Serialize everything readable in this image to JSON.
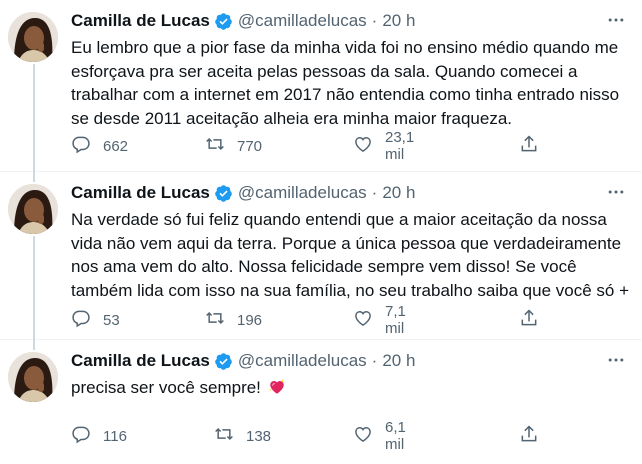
{
  "tweets": [
    {
      "author": "Camilla de Lucas",
      "handle": "@camilladelucas",
      "separator": "·",
      "time": "20 h",
      "text": "Eu lembro que a pior fase da minha vida foi no ensino médio quando me esforçava pra ser aceita pelas pessoas da sala. Quando comecei a trabalhar com a internet em 2017 não entendia como tinha entrado nisso se desde 2011 aceitação alheia era minha maior fraqueza.",
      "replies": "662",
      "retweets": "770",
      "likes": "23,1 mil"
    },
    {
      "author": "Camilla de Lucas",
      "handle": "@camilladelucas",
      "separator": "·",
      "time": "20 h",
      "text": "Na verdade só fui feliz quando entendi que a maior aceitação da nossa vida não vem aqui da terra. Porque a única pessoa que verdadeiramente nos ama vem do alto. Nossa felicidade sempre vem disso! Se você também lida com isso na sua família, no seu trabalho saiba que você só +",
      "replies": "53",
      "retweets": "196",
      "likes": "7,1 mil"
    },
    {
      "author": "Camilla de Lucas",
      "handle": "@camilladelucas",
      "separator": "·",
      "time": "20 h",
      "text": "precisa ser você sempre!",
      "replies": "116",
      "retweets": "138",
      "likes": "6,1 mil"
    }
  ],
  "colors": {
    "accent": "#1d9bf0",
    "muted": "#536471",
    "text": "#0f1419",
    "thread_line": "#cfd9de",
    "heart_emoji": "#e0245e"
  },
  "icons": [
    "verified-badge-icon",
    "more-icon",
    "reply-icon",
    "retweet-icon",
    "like-icon",
    "share-icon",
    "sparkling-heart-emoji"
  ]
}
